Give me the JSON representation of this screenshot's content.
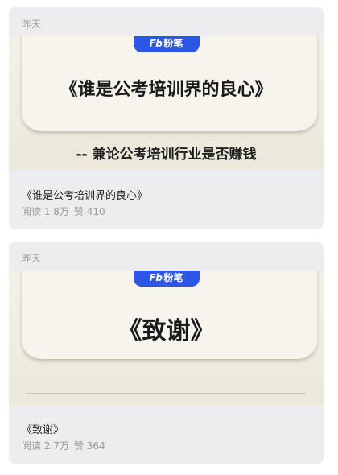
{
  "articles": [
    {
      "date": "昨天",
      "brand": {
        "logo": "Fb",
        "name": "粉笔",
        "color": "#2b56e8"
      },
      "cover_title": "《谁是公考培训界的良心》",
      "cover_subtitle": "-- 兼论公考培训行业是否赚钱",
      "title": "《谁是公考培训界的良心》",
      "reads": "阅读 1.8万",
      "likes": "赞 410"
    },
    {
      "date": "昨天",
      "brand": {
        "logo": "Fb",
        "name": "粉笔",
        "color": "#2b56e8"
      },
      "cover_title": "《致谢》",
      "title": "《致谢》",
      "reads": "阅读 2.7万",
      "likes": "赞 364"
    }
  ]
}
